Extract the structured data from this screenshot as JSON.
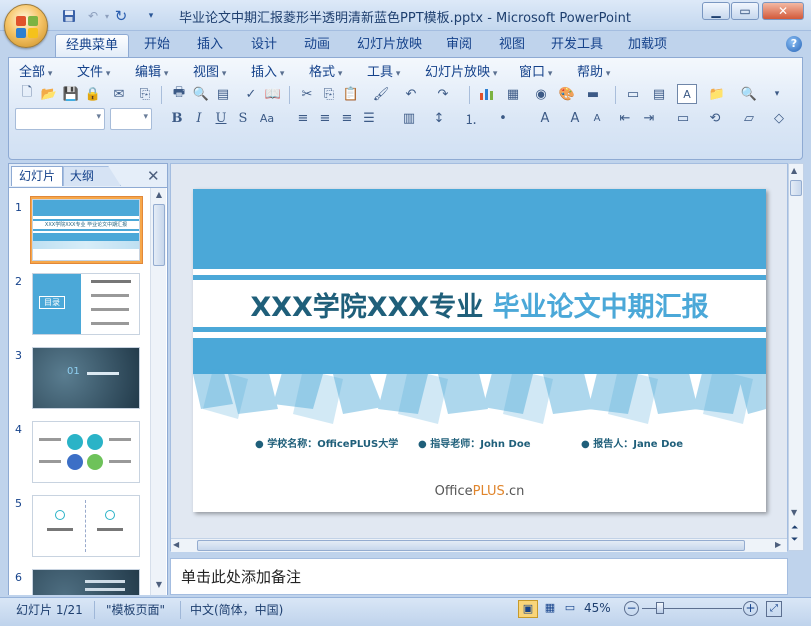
{
  "window": {
    "title": "毕业论文中期汇报菱形半透明清新蓝色PPT模板.pptx - Microsoft PowerPoint",
    "minimize_icon": "minimize-icon",
    "maximize_icon": "maximize-icon",
    "close_icon": "close-icon"
  },
  "qat": {
    "save_icon": "save-icon",
    "undo_icon": "undo-icon",
    "redo_icon": "redo-icon",
    "customize_icon": "chevron-down-icon"
  },
  "ribbon_tabs": [
    {
      "label": "经典菜单",
      "active": true
    },
    {
      "label": "开始"
    },
    {
      "label": "插入"
    },
    {
      "label": "设计"
    },
    {
      "label": "动画"
    },
    {
      "label": "幻灯片放映"
    },
    {
      "label": "审阅"
    },
    {
      "label": "视图"
    },
    {
      "label": "开发工具"
    },
    {
      "label": "加载项"
    }
  ],
  "classic_menu": [
    "全部",
    "文件",
    "编辑",
    "视图",
    "插入",
    "格式",
    "工具",
    "幻灯片放映",
    "窗口",
    "帮助"
  ],
  "format_bar": {
    "bold": "B",
    "italic": "I",
    "underline": "U",
    "shadow": "S",
    "char_spacing": "Aa"
  },
  "panel_tabs": {
    "slides": "幻灯片",
    "outline": "大纲",
    "close": "✕"
  },
  "thumbnails": [
    {
      "num": "1",
      "title": "XXX学院XXX专业 毕业论文中期汇报",
      "selected": true
    },
    {
      "num": "2",
      "title": "目录"
    },
    {
      "num": "3",
      "title": "01"
    },
    {
      "num": "4",
      "title": ""
    },
    {
      "num": "5",
      "title": ""
    },
    {
      "num": "6",
      "title": ""
    }
  ],
  "slide": {
    "title_part1": "XXX学院XXX专业",
    "title_part2": "毕业论文中期汇报",
    "info": [
      "学校名称：OfficePLUS大学",
      "指导老师：John Doe",
      "报告人：Jane Doe"
    ],
    "brand_office": "Office",
    "brand_plus": "PLUS",
    "brand_cn": ".cn",
    "colors": {
      "band": "#4ba8d8",
      "title_dark": "#1f5f7a",
      "title_light": "#4ba8d8"
    }
  },
  "notes_placeholder": "单击此处添加备注",
  "status": {
    "slide_counter": "幻灯片 1/21",
    "theme": "\"模板页面\"",
    "language": "中文(简体，中国)",
    "zoom": "45%"
  }
}
